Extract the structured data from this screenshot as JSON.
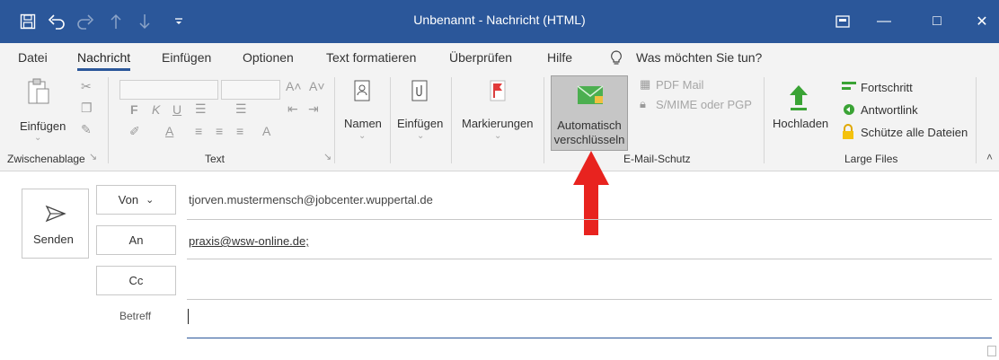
{
  "window": {
    "title": "Unbenannt  -  Nachricht (HTML)",
    "quick_access_icons": [
      "save-icon",
      "undo-icon",
      "redo-icon",
      "up-arrow-icon",
      "down-arrow-icon",
      "customize-icon"
    ],
    "controls": [
      "ribbon-display-icon",
      "minimize-icon",
      "maximize-icon",
      "close-icon"
    ],
    "minimize_glyph": "—",
    "maximize_glyph": "□",
    "close_glyph": "✕"
  },
  "menu": {
    "items": [
      "Datei",
      "Nachricht",
      "Einfügen",
      "Optionen",
      "Text formatieren",
      "Überprüfen",
      "Hilfe"
    ],
    "active": "Nachricht",
    "tell_me": "Was möchten Sie tun?"
  },
  "ribbon": {
    "clipboard": {
      "paste_label": "Einfügen",
      "group_label": "Zwischenablage"
    },
    "text": {
      "group_label": "Text",
      "bold": "F",
      "italic": "K",
      "underline": "U"
    },
    "names": {
      "label": "Namen"
    },
    "insert": {
      "label": "Einfügen"
    },
    "tags": {
      "label": "Markierungen"
    },
    "email_protection": {
      "auto_encrypt_line1": "Automatisch",
      "auto_encrypt_line2": "verschlüsseln",
      "pdf_mail": "PDF Mail",
      "smime": "S/MIME oder PGP",
      "group_label": "E-Mail-Schutz"
    },
    "large_files": {
      "upload": "Hochladen",
      "progress": "Fortschritt",
      "reply_link": "Antwortlink",
      "protect_all": "Schütze alle Dateien",
      "group_label": "Large Files"
    }
  },
  "compose": {
    "send_label": "Senden",
    "from_label": "Von",
    "from_value": "tjorven.mustermensch@jobcenter.wuppertal.de",
    "to_label": "An",
    "to_value": "praxis@wsw-online.de;",
    "cc_label": "Cc",
    "cc_value": "",
    "subject_label": "Betreff",
    "subject_value": ""
  },
  "colors": {
    "titlebar": "#2b579a",
    "ribbon": "#f3f3f3",
    "annotation_arrow": "#e8231f"
  }
}
